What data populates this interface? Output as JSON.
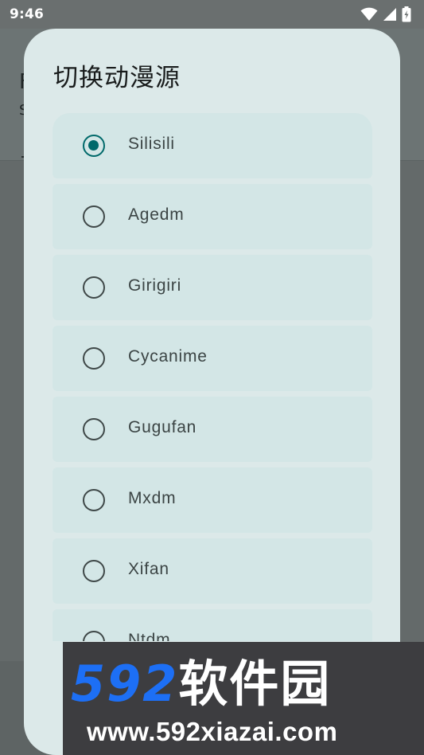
{
  "status_bar": {
    "time": "9:46",
    "icons": [
      "wifi-icon",
      "cellular-signal-icon",
      "battery-charging-icon"
    ]
  },
  "background_app": {
    "title_partial": "F",
    "subtitle_partial": "S"
  },
  "dialog": {
    "title": "切换动漫源",
    "options": [
      {
        "label": "Silisili",
        "selected": true
      },
      {
        "label": "Agedm",
        "selected": false
      },
      {
        "label": "Girigiri",
        "selected": false
      },
      {
        "label": "Cycanime",
        "selected": false
      },
      {
        "label": "Gugufan",
        "selected": false
      },
      {
        "label": "Mxdm",
        "selected": false
      },
      {
        "label": "Xifan",
        "selected": false
      },
      {
        "label": "Ntdm",
        "selected": false
      }
    ]
  },
  "watermark": {
    "brand_number": "592",
    "brand_text": "软件园",
    "url": "www.592xiazai.com"
  },
  "colors": {
    "accent": "#00696a",
    "dialog_bg": "#dce9e9",
    "item_bg": "#d3e6e6",
    "scrim": "#6a6f6f",
    "watermark_blue": "#1d6ff5"
  }
}
